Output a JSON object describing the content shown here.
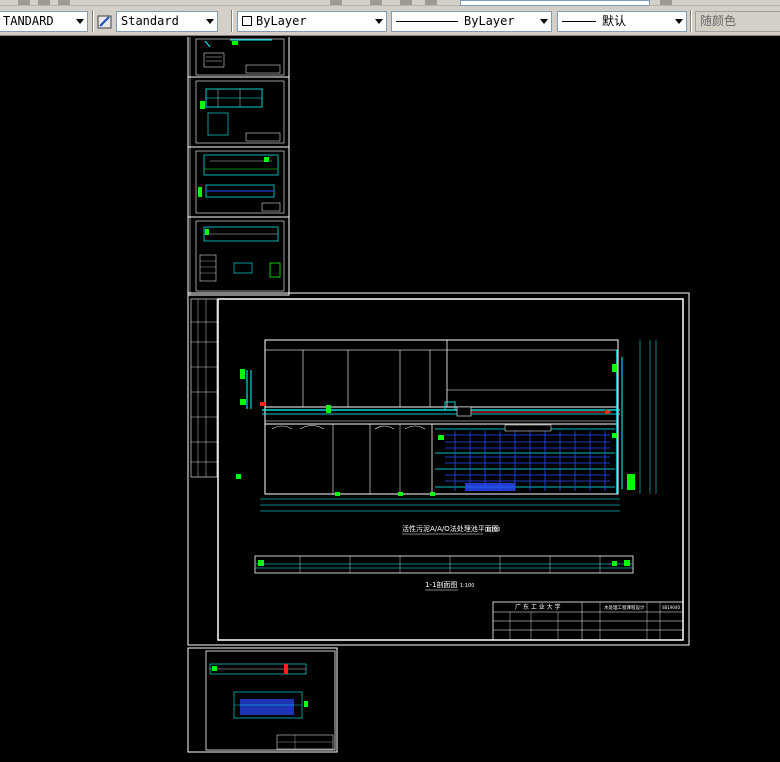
{
  "toolbar": {
    "text_style": "TANDARD",
    "dim_style": "Standard",
    "layer": "ByLayer",
    "linetype": "ByLayer",
    "lineweight": "默认",
    "plot_color": "随颜色"
  },
  "icons": {
    "dim_style": "dimension-style-icon",
    "layer_swatch": "color-swatch-icon"
  },
  "drawing": {
    "main_title": "活性污泥A/A/O法处理池平面图",
    "main_scale": "1:100",
    "section_title": "1-1剖面图",
    "section_scale": "1:100",
    "title_block": {
      "school": "广 东 工 业 大 学",
      "project": "水处理工程课程设计",
      "sheet_no": "SB19040"
    }
  },
  "colors": {
    "canvas": "#000000",
    "frame": "#ffffff",
    "cyan": "#00ffff",
    "blue": "#2a4bff",
    "green": "#00ff00",
    "red": "#ff2020",
    "toolbar": "#d4d0c8"
  }
}
